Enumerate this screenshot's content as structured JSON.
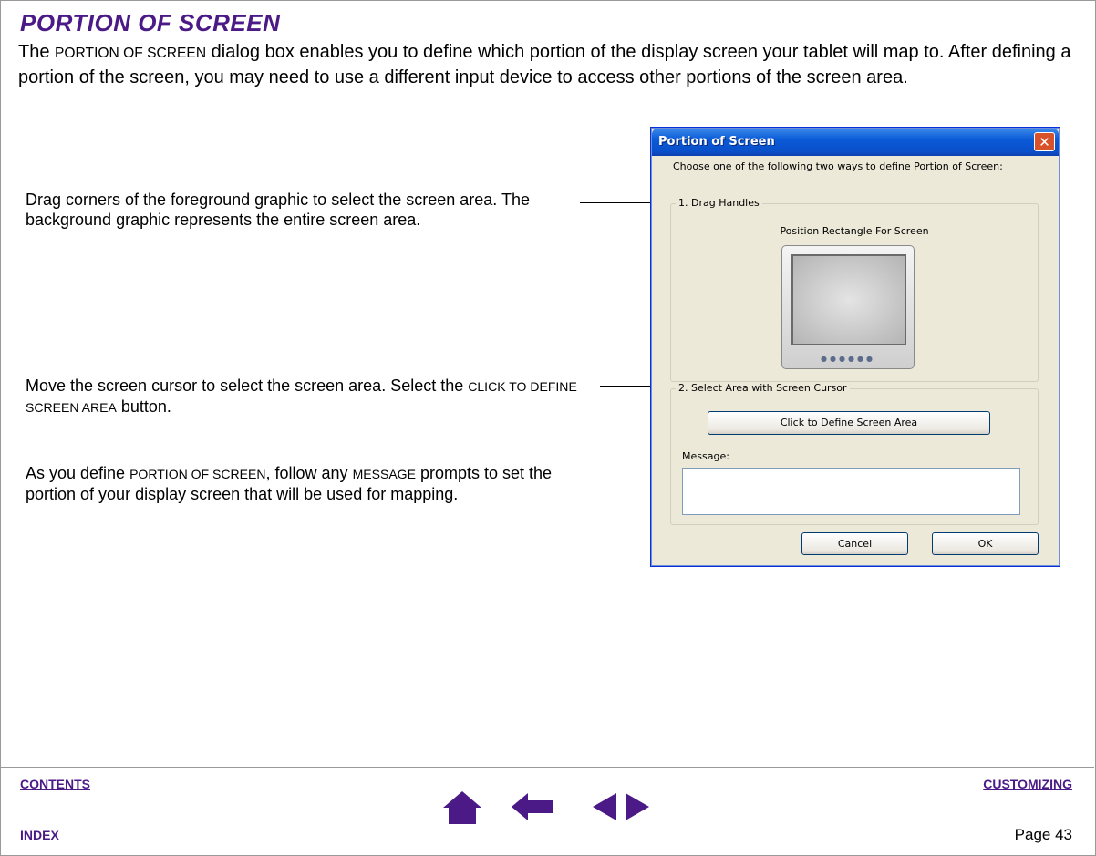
{
  "page": {
    "title": "PORTION OF SCREEN",
    "intro": {
      "p1": "The ",
      "sc1": "Portion of Screen",
      "p2": " dialog box enables you to define which portion of the display screen your tablet will map to. After defining a portion of the screen, you may need to use a different input device to access other portions of the screen area."
    }
  },
  "callouts": {
    "drag": "Drag corners of the foreground graphic to select the screen area. The background graphic represents the entire screen area.",
    "cursor": {
      "p1": "Move the screen cursor to select the screen area.  Select the ",
      "sc1": "Click to define screen area",
      "p2": " button."
    },
    "message": {
      "p1": "As you define ",
      "sc1": "Portion of Screen",
      "p2": ", follow any ",
      "sc2": "Message",
      "p3": " prompts to set the portion of your display screen that will be used for mapping."
    }
  },
  "dialog": {
    "title": "Portion of Screen",
    "close_glyph": "✕",
    "prompt": "Choose one of the following two ways to define Portion of Screen:",
    "group1": {
      "label": "1. Drag Handles",
      "rect_label": "Position Rectangle For Screen",
      "monitor_buttons": "●●●●●●"
    },
    "group2": {
      "label": "2. Select Area with Screen Cursor",
      "button": "Click to Define Screen Area",
      "message_label": "Message:",
      "message_value": ""
    },
    "cancel": "Cancel",
    "ok": "OK"
  },
  "footer": {
    "contents": "Contents",
    "index": "Index",
    "customizing": "Customizing",
    "page": "Page  43",
    "icon_color": "#4b1a86"
  }
}
